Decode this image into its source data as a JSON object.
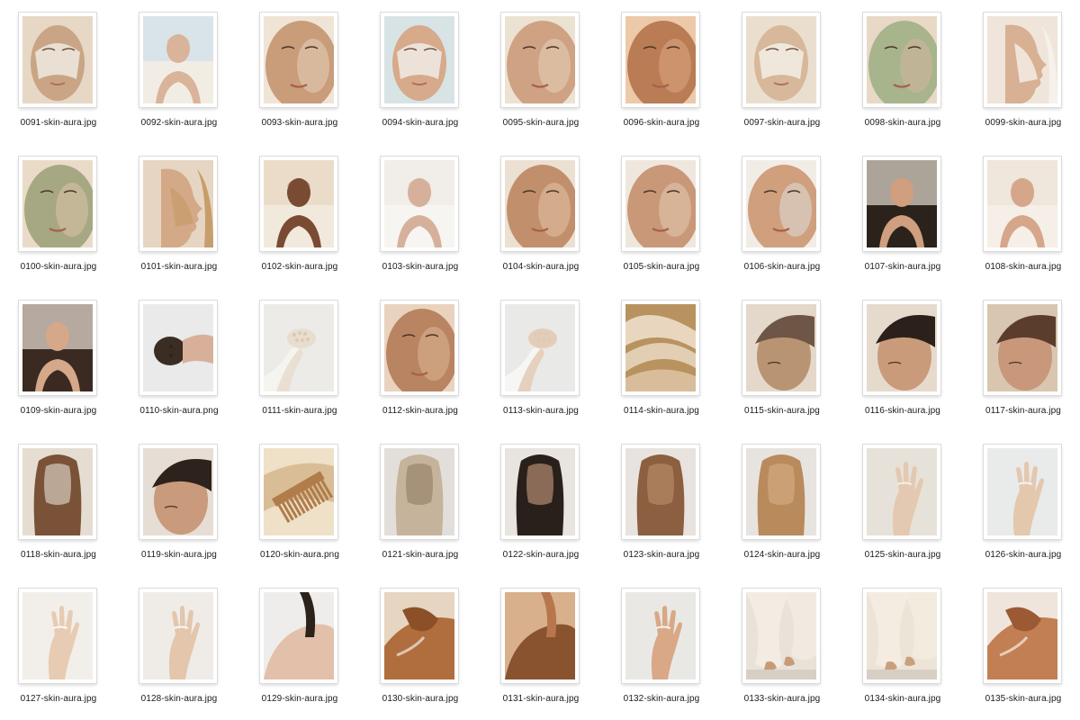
{
  "files": [
    {
      "name": "0091-skin-aura.jpg",
      "subject": "face-mask",
      "colors": [
        "#e7d7c5",
        "#c9a586",
        "#efe9df"
      ]
    },
    {
      "name": "0092-skin-aura.jpg",
      "subject": "portrait",
      "colors": [
        "#cfe0ec",
        "#d9b49a",
        "#f2ede4"
      ]
    },
    {
      "name": "0093-skin-aura.jpg",
      "subject": "face-closeup",
      "colors": [
        "#e4cdb6",
        "#c99c7a",
        "#efe4d6"
      ]
    },
    {
      "name": "0094-skin-aura.jpg",
      "subject": "face-mask",
      "colors": [
        "#d8e3e6",
        "#d6aa8a",
        "#f1ece6"
      ]
    },
    {
      "name": "0095-skin-aura.jpg",
      "subject": "face-closeup",
      "colors": [
        "#e3cdb6",
        "#cfa283",
        "#ece2d2"
      ]
    },
    {
      "name": "0096-skin-aura.jpg",
      "subject": "face-closeup",
      "colors": [
        "#d8a47b",
        "#b97c55",
        "#ecc9a8"
      ]
    },
    {
      "name": "0097-skin-aura.jpg",
      "subject": "face-mask",
      "colors": [
        "#eadfcf",
        "#d8b89a",
        "#f3eee6"
      ]
    },
    {
      "name": "0098-skin-aura.jpg",
      "subject": "face-closeup",
      "colors": [
        "#cfb59d",
        "#a7b48c",
        "#e8d8c6"
      ]
    },
    {
      "name": "0099-skin-aura.jpg",
      "subject": "profile",
      "colors": [
        "#efe5db",
        "#d8b094",
        "#f6f1ea"
      ]
    },
    {
      "name": "0100-skin-aura.jpg",
      "subject": "face-closeup",
      "colors": [
        "#d9c1a7",
        "#a6a883",
        "#eadbc9"
      ]
    },
    {
      "name": "0101-skin-aura.jpg",
      "subject": "profile",
      "colors": [
        "#e6d5c3",
        "#d4a987",
        "#c79d6b"
      ]
    },
    {
      "name": "0102-skin-aura.jpg",
      "subject": "portrait",
      "colors": [
        "#e8d6c0",
        "#7a4b33",
        "#f2e9dd"
      ]
    },
    {
      "name": "0103-skin-aura.jpg",
      "subject": "portrait",
      "colors": [
        "#eeeae4",
        "#d6b09a",
        "#f7f5f1"
      ]
    },
    {
      "name": "0104-skin-aura.jpg",
      "subject": "face-closeup",
      "colors": [
        "#dfc0a2",
        "#c28f6c",
        "#ece0d2"
      ]
    },
    {
      "name": "0105-skin-aura.jpg",
      "subject": "face-closeup",
      "colors": [
        "#e1c4ad",
        "#c99878",
        "#efe7de"
      ]
    },
    {
      "name": "0106-skin-aura.jpg",
      "subject": "face-closeup",
      "colors": [
        "#dcd9d4",
        "#cf9f7e",
        "#f1ece6"
      ]
    },
    {
      "name": "0107-skin-aura.jpg",
      "subject": "portrait",
      "colors": [
        "#e6dccf",
        "#cf9f80",
        "#2b221c"
      ]
    },
    {
      "name": "0108-skin-aura.jpg",
      "subject": "portrait",
      "colors": [
        "#ece2d7",
        "#d6a68a",
        "#f5efe8"
      ]
    },
    {
      "name": "0109-skin-aura.jpg",
      "subject": "portrait",
      "colors": [
        "#e9e0d6",
        "#d5a88a",
        "#3a2a22"
      ]
    },
    {
      "name": "0110-skin-aura.png",
      "subject": "lying-mask",
      "colors": [
        "#e9eae9",
        "#d8b09a",
        "#3b2c24"
      ]
    },
    {
      "name": "0111-skin-aura.jpg",
      "subject": "hand-tool",
      "colors": [
        "#ecebe7",
        "#e8ddcf",
        "#f6f4ef"
      ]
    },
    {
      "name": "0112-skin-aura.jpg",
      "subject": "face-closeup",
      "colors": [
        "#d8b18f",
        "#b98461",
        "#e9d3bf"
      ]
    },
    {
      "name": "0113-skin-aura.jpg",
      "subject": "hand-tool",
      "colors": [
        "#e9e9e7",
        "#e4cdb8",
        "#f6f6f4"
      ]
    },
    {
      "name": "0114-skin-aura.jpg",
      "subject": "cream-swirl",
      "colors": [
        "#d9bd9a",
        "#b8935f",
        "#f0e3cf"
      ]
    },
    {
      "name": "0115-skin-aura.jpg",
      "subject": "hair-side",
      "colors": [
        "#e4d8cb",
        "#b89472",
        "#6e5646"
      ]
    },
    {
      "name": "0116-skin-aura.jpg",
      "subject": "hair-side",
      "colors": [
        "#e6dacd",
        "#c99b7a",
        "#2c211a"
      ]
    },
    {
      "name": "0117-skin-aura.jpg",
      "subject": "hair-side",
      "colors": [
        "#d8c6b0",
        "#c9977a",
        "#5b3d2b"
      ]
    },
    {
      "name": "0118-skin-aura.jpg",
      "subject": "hair-long",
      "colors": [
        "#e5ddd2",
        "#7a5237",
        "#f1ece6"
      ]
    },
    {
      "name": "0119-skin-aura.jpg",
      "subject": "hair-side",
      "colors": [
        "#e6ddd4",
        "#c99a7b",
        "#2d221c"
      ]
    },
    {
      "name": "0120-skin-aura.png",
      "subject": "comb-hair",
      "colors": [
        "#d9bd96",
        "#b07c4a",
        "#efe0c8"
      ]
    },
    {
      "name": "0121-skin-aura.jpg",
      "subject": "hair-long",
      "colors": [
        "#e2dfdb",
        "#c6b39b",
        "#8c745c"
      ]
    },
    {
      "name": "0122-skin-aura.jpg",
      "subject": "hair-long",
      "colors": [
        "#e8e4df",
        "#2a201b",
        "#d7a98a"
      ]
    },
    {
      "name": "0123-skin-aura.jpg",
      "subject": "hair-long",
      "colors": [
        "#e8e3de",
        "#8b5f3f",
        "#c39670"
      ]
    },
    {
      "name": "0124-skin-aura.jpg",
      "subject": "hair-long",
      "colors": [
        "#e7e3df",
        "#b98a5c",
        "#d8b388"
      ]
    },
    {
      "name": "0125-skin-aura.jpg",
      "subject": "hands",
      "colors": [
        "#e7e2d9",
        "#e3c9b1",
        "#f3efe9"
      ]
    },
    {
      "name": "0126-skin-aura.jpg",
      "subject": "hands",
      "colors": [
        "#e9eaea",
        "#e3c8ae",
        "#f5f5f5"
      ]
    },
    {
      "name": "0127-skin-aura.jpg",
      "subject": "hands",
      "colors": [
        "#f2efeb",
        "#e7cbb2",
        "#faf8f6"
      ]
    },
    {
      "name": "0128-skin-aura.jpg",
      "subject": "hands",
      "colors": [
        "#efece8",
        "#e3c6ac",
        "#f9f7f4"
      ]
    },
    {
      "name": "0129-skin-aura.jpg",
      "subject": "shoulder",
      "colors": [
        "#efedeb",
        "#e2c0aa",
        "#2b221c"
      ]
    },
    {
      "name": "0130-skin-aura.jpg",
      "subject": "skin-arm",
      "colors": [
        "#e6d5c0",
        "#b06e3f",
        "#8b5028"
      ]
    },
    {
      "name": "0131-skin-aura.jpg",
      "subject": "shoulder",
      "colors": [
        "#d8b08b",
        "#8a532f",
        "#b7764b"
      ]
    },
    {
      "name": "0132-skin-aura.jpg",
      "subject": "hands",
      "colors": [
        "#eae8e4",
        "#d9a886",
        "#f5f3f0"
      ]
    },
    {
      "name": "0133-skin-aura.jpg",
      "subject": "feet-drape",
      "colors": [
        "#e9e2d8",
        "#f3ece2",
        "#c79b78"
      ]
    },
    {
      "name": "0134-skin-aura.jpg",
      "subject": "feet-drape",
      "colors": [
        "#ece4d7",
        "#f4ece0",
        "#caa07c"
      ]
    },
    {
      "name": "0135-skin-aura.jpg",
      "subject": "skin-arm",
      "colors": [
        "#efe5dc",
        "#c17f53",
        "#9b5a34"
      ]
    }
  ]
}
